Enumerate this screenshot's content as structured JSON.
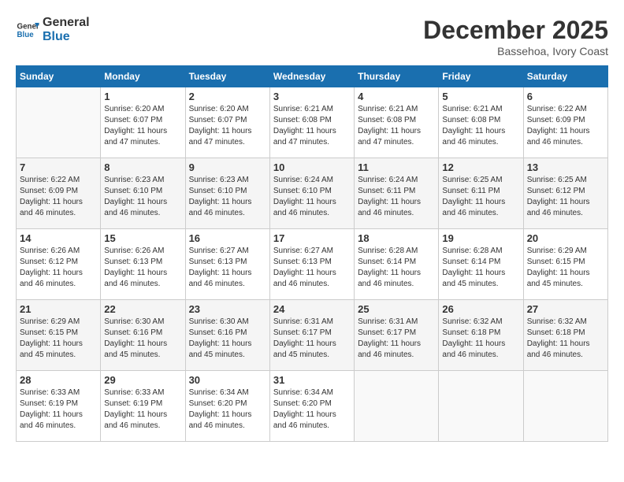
{
  "logo": {
    "line1": "General",
    "line2": "Blue"
  },
  "title": "December 2025",
  "subtitle": "Bassehoa, Ivory Coast",
  "days_header": [
    "Sunday",
    "Monday",
    "Tuesday",
    "Wednesday",
    "Thursday",
    "Friday",
    "Saturday"
  ],
  "weeks": [
    [
      {
        "day": "",
        "info": ""
      },
      {
        "day": "1",
        "info": "Sunrise: 6:20 AM\nSunset: 6:07 PM\nDaylight: 11 hours and 47 minutes."
      },
      {
        "day": "2",
        "info": "Sunrise: 6:20 AM\nSunset: 6:07 PM\nDaylight: 11 hours and 47 minutes."
      },
      {
        "day": "3",
        "info": "Sunrise: 6:21 AM\nSunset: 6:08 PM\nDaylight: 11 hours and 47 minutes."
      },
      {
        "day": "4",
        "info": "Sunrise: 6:21 AM\nSunset: 6:08 PM\nDaylight: 11 hours and 47 minutes."
      },
      {
        "day": "5",
        "info": "Sunrise: 6:21 AM\nSunset: 6:08 PM\nDaylight: 11 hours and 46 minutes."
      },
      {
        "day": "6",
        "info": "Sunrise: 6:22 AM\nSunset: 6:09 PM\nDaylight: 11 hours and 46 minutes."
      }
    ],
    [
      {
        "day": "7",
        "info": "Sunrise: 6:22 AM\nSunset: 6:09 PM\nDaylight: 11 hours and 46 minutes."
      },
      {
        "day": "8",
        "info": "Sunrise: 6:23 AM\nSunset: 6:10 PM\nDaylight: 11 hours and 46 minutes."
      },
      {
        "day": "9",
        "info": "Sunrise: 6:23 AM\nSunset: 6:10 PM\nDaylight: 11 hours and 46 minutes."
      },
      {
        "day": "10",
        "info": "Sunrise: 6:24 AM\nSunset: 6:10 PM\nDaylight: 11 hours and 46 minutes."
      },
      {
        "day": "11",
        "info": "Sunrise: 6:24 AM\nSunset: 6:11 PM\nDaylight: 11 hours and 46 minutes."
      },
      {
        "day": "12",
        "info": "Sunrise: 6:25 AM\nSunset: 6:11 PM\nDaylight: 11 hours and 46 minutes."
      },
      {
        "day": "13",
        "info": "Sunrise: 6:25 AM\nSunset: 6:12 PM\nDaylight: 11 hours and 46 minutes."
      }
    ],
    [
      {
        "day": "14",
        "info": "Sunrise: 6:26 AM\nSunset: 6:12 PM\nDaylight: 11 hours and 46 minutes."
      },
      {
        "day": "15",
        "info": "Sunrise: 6:26 AM\nSunset: 6:13 PM\nDaylight: 11 hours and 46 minutes."
      },
      {
        "day": "16",
        "info": "Sunrise: 6:27 AM\nSunset: 6:13 PM\nDaylight: 11 hours and 46 minutes."
      },
      {
        "day": "17",
        "info": "Sunrise: 6:27 AM\nSunset: 6:13 PM\nDaylight: 11 hours and 46 minutes."
      },
      {
        "day": "18",
        "info": "Sunrise: 6:28 AM\nSunset: 6:14 PM\nDaylight: 11 hours and 46 minutes."
      },
      {
        "day": "19",
        "info": "Sunrise: 6:28 AM\nSunset: 6:14 PM\nDaylight: 11 hours and 45 minutes."
      },
      {
        "day": "20",
        "info": "Sunrise: 6:29 AM\nSunset: 6:15 PM\nDaylight: 11 hours and 45 minutes."
      }
    ],
    [
      {
        "day": "21",
        "info": "Sunrise: 6:29 AM\nSunset: 6:15 PM\nDaylight: 11 hours and 45 minutes."
      },
      {
        "day": "22",
        "info": "Sunrise: 6:30 AM\nSunset: 6:16 PM\nDaylight: 11 hours and 45 minutes."
      },
      {
        "day": "23",
        "info": "Sunrise: 6:30 AM\nSunset: 6:16 PM\nDaylight: 11 hours and 45 minutes."
      },
      {
        "day": "24",
        "info": "Sunrise: 6:31 AM\nSunset: 6:17 PM\nDaylight: 11 hours and 45 minutes."
      },
      {
        "day": "25",
        "info": "Sunrise: 6:31 AM\nSunset: 6:17 PM\nDaylight: 11 hours and 46 minutes."
      },
      {
        "day": "26",
        "info": "Sunrise: 6:32 AM\nSunset: 6:18 PM\nDaylight: 11 hours and 46 minutes."
      },
      {
        "day": "27",
        "info": "Sunrise: 6:32 AM\nSunset: 6:18 PM\nDaylight: 11 hours and 46 minutes."
      }
    ],
    [
      {
        "day": "28",
        "info": "Sunrise: 6:33 AM\nSunset: 6:19 PM\nDaylight: 11 hours and 46 minutes."
      },
      {
        "day": "29",
        "info": "Sunrise: 6:33 AM\nSunset: 6:19 PM\nDaylight: 11 hours and 46 minutes."
      },
      {
        "day": "30",
        "info": "Sunrise: 6:34 AM\nSunset: 6:20 PM\nDaylight: 11 hours and 46 minutes."
      },
      {
        "day": "31",
        "info": "Sunrise: 6:34 AM\nSunset: 6:20 PM\nDaylight: 11 hours and 46 minutes."
      },
      {
        "day": "",
        "info": ""
      },
      {
        "day": "",
        "info": ""
      },
      {
        "day": "",
        "info": ""
      }
    ]
  ]
}
